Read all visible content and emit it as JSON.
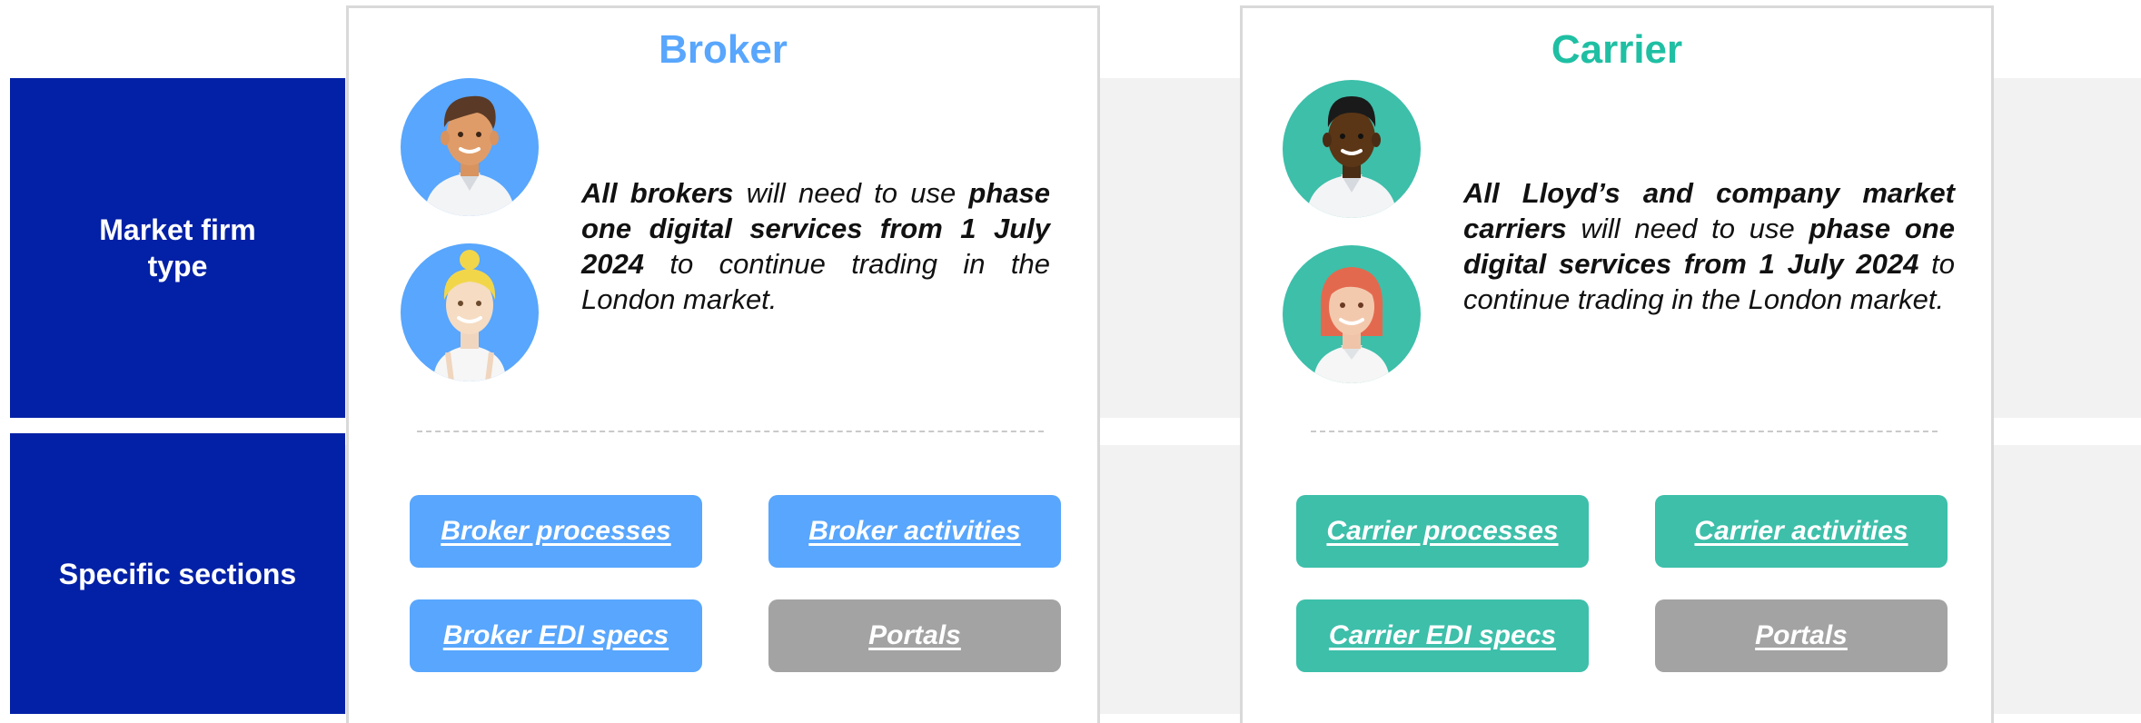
{
  "colors": {
    "row_label_bg": "#0321a6",
    "broker_accent": "#58a6fd",
    "carrier_accent": "#3dbfaa",
    "portal_gray": "#a3a3a3",
    "band_gray": "#f2f2f2"
  },
  "rows": {
    "market_firm_type": "Market firm\ntype",
    "specific_sections": "Specific sections"
  },
  "broker": {
    "title": "Broker",
    "desc": {
      "p1": "All brokers",
      "p2": " will need to use ",
      "p3": "phase one digital services from 1 July 2024",
      "p4": " to continue trading in the London market."
    },
    "avatars": [
      "man-avatar-icon",
      "woman-avatar-icon"
    ],
    "buttons": {
      "processes": "Broker processes",
      "activities": "Broker activities",
      "edi": "Broker EDI specs",
      "portals": "Portals"
    }
  },
  "carrier": {
    "title": "Carrier",
    "desc": {
      "p1": "All Lloyd’s and company market carriers",
      "p2": " will need to use ",
      "p3": "phase one digital services from 1 July 2024",
      "p4": " to continue trading in the London market."
    },
    "avatars": [
      "man-avatar-icon",
      "woman-avatar-icon"
    ],
    "buttons": {
      "processes": "Carrier processes",
      "activities": "Carrier activities",
      "edi": "Carrier EDI specs",
      "portals": "Portals"
    }
  }
}
